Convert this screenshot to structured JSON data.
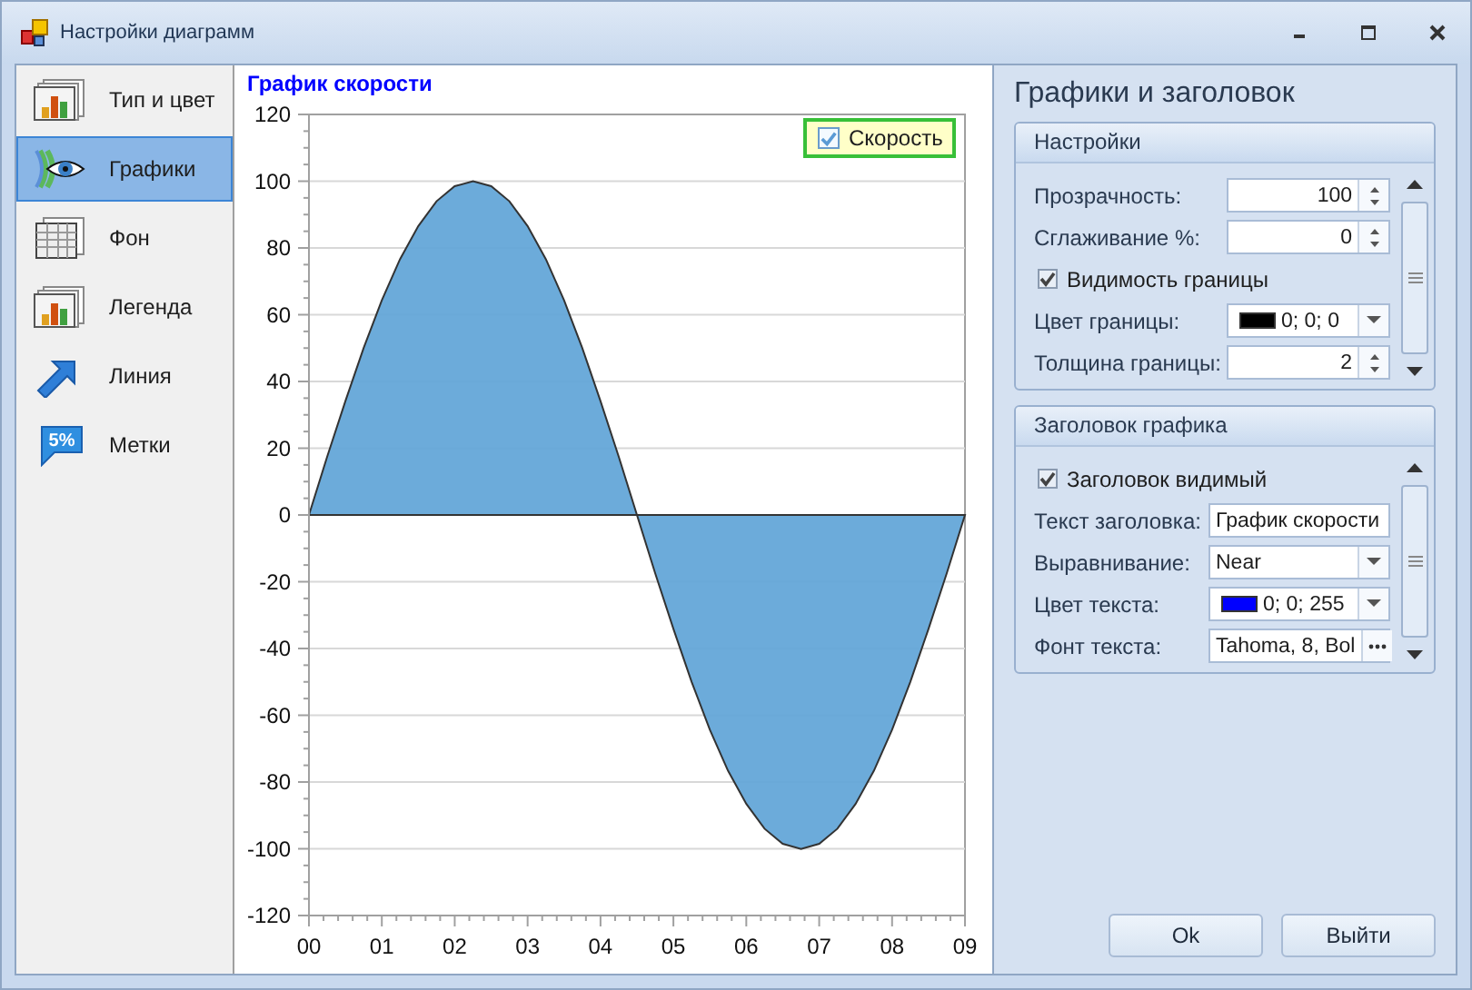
{
  "window": {
    "title": "Настройки диаграмм"
  },
  "sidebar": {
    "items": [
      {
        "label": "Тип и цвет",
        "selected": false
      },
      {
        "label": "Графики",
        "selected": true
      },
      {
        "label": "Фон",
        "selected": false
      },
      {
        "label": "Легенда",
        "selected": false
      },
      {
        "label": "Линия",
        "selected": false
      },
      {
        "label": "Метки",
        "selected": false,
        "icon_text": "5%"
      }
    ]
  },
  "chart": {
    "title": "График скорости",
    "legend": {
      "checked": true
    },
    "chart_data": {
      "type": "area",
      "grid": true,
      "x": [
        0,
        0.25,
        0.5,
        0.75,
        1,
        1.25,
        1.5,
        1.75,
        2,
        2.25,
        2.5,
        2.75,
        3,
        3.25,
        3.5,
        3.75,
        4,
        4.25,
        4.5,
        4.75,
        5,
        5.25,
        5.5,
        5.75,
        6,
        6.25,
        6.5,
        6.75,
        7,
        7.25,
        7.5,
        7.75,
        8,
        8.25,
        8.5,
        8.75,
        9
      ],
      "series": [
        {
          "name": "Скорость",
          "color": "#64a6d8",
          "values": [
            0,
            17.4,
            34.2,
            50,
            64.3,
            76.6,
            86.6,
            94,
            98.5,
            100,
            98.5,
            94,
            86.6,
            76.6,
            64.3,
            50,
            34.2,
            17.4,
            0,
            -17.4,
            -34.2,
            -50,
            -64.3,
            -76.6,
            -86.6,
            -94,
            -98.5,
            -100,
            -98.5,
            -94,
            -86.6,
            -76.6,
            -64.3,
            -50,
            -34.2,
            -17.4,
            0
          ]
        }
      ],
      "xlim": [
        0,
        9
      ],
      "ylim": [
        -120,
        120
      ],
      "xticks": [
        {
          "value": 0,
          "label": "00"
        },
        {
          "value": 1,
          "label": "01"
        },
        {
          "value": 2,
          "label": "02"
        },
        {
          "value": 3,
          "label": "03"
        },
        {
          "value": 4,
          "label": "04"
        },
        {
          "value": 5,
          "label": "05"
        },
        {
          "value": 6,
          "label": "06"
        },
        {
          "value": 7,
          "label": "07"
        },
        {
          "value": 8,
          "label": "08"
        },
        {
          "value": 9,
          "label": "09"
        }
      ],
      "yticks": [
        -120,
        -100,
        -80,
        -60,
        -40,
        -20,
        0,
        20,
        40,
        60,
        80,
        100,
        120
      ]
    }
  },
  "panel": {
    "title": "Графики и заголовок",
    "groups": [
      {
        "title": "Настройки",
        "rows": [
          {
            "kind": "spin",
            "label": "Прозрачность:",
            "value": "100"
          },
          {
            "kind": "spin",
            "label": "Сглаживание %:",
            "value": "0"
          },
          {
            "kind": "checkbox",
            "label": "Видимость границы",
            "checked": true
          },
          {
            "kind": "color",
            "label": "Цвет границы:",
            "value": "0; 0; 0",
            "color": "#000000"
          },
          {
            "kind": "spin",
            "label": "Толщина границы:",
            "value": "2"
          }
        ]
      },
      {
        "title": "Заголовок графика",
        "rows": [
          {
            "kind": "checkbox",
            "label": "Заголовок видимый",
            "checked": true
          },
          {
            "kind": "text",
            "label": "Текст заголовка:",
            "value": "График скорости"
          },
          {
            "kind": "combo",
            "label": "Выравнивание:",
            "value": "Near"
          },
          {
            "kind": "color",
            "label": "Цвет текста:",
            "value": "0; 0; 255",
            "color": "#0000ff"
          },
          {
            "kind": "ellipsis",
            "label": "Фонт текста:",
            "value": "Tahoma, 8, Bol"
          }
        ]
      }
    ]
  },
  "buttons": [
    "Ok",
    "Выйти"
  ]
}
